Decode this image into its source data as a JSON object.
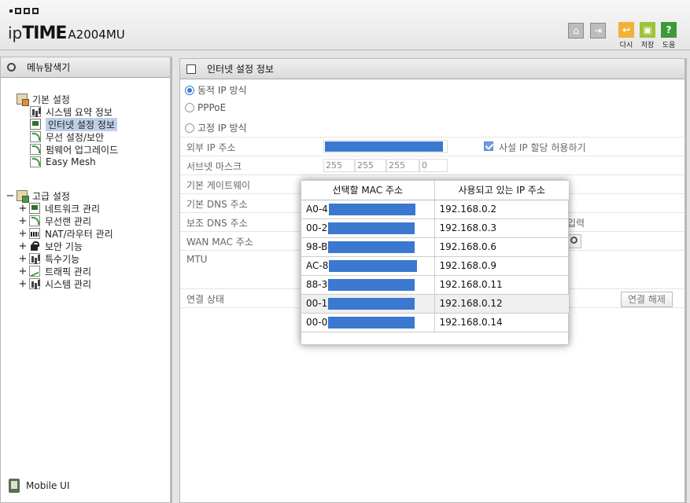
{
  "brand": {
    "logo_ip": "ip",
    "logo_time": "TIME",
    "model": "A2004MU"
  },
  "header_buttons": [
    {
      "name": "home",
      "icon": "home-icon"
    },
    {
      "name": "logout",
      "icon": "logout-icon"
    },
    {
      "name": "undo",
      "label": "다시",
      "icon": "undo-icon",
      "color": "#f0b23b"
    },
    {
      "name": "save",
      "label": "저장",
      "icon": "save-icon",
      "color": "#9cc33a"
    },
    {
      "name": "help",
      "label": "도움",
      "icon": "help-icon",
      "color": "#3c9a3a"
    }
  ],
  "sidebar": {
    "title": "메뉴탐색기",
    "basic": {
      "label": "기본 설정",
      "items": [
        "시스템 요약 정보",
        "인터넷 설정 정보",
        "무선 설정/보안",
        "펌웨어 업그레이드",
        "Easy Mesh"
      ]
    },
    "advanced": {
      "toggle": "−",
      "label": "고급 설정",
      "items": [
        "네트워크 관리",
        "무선랜 관리",
        "NAT/라우터 관리",
        "보안 기능",
        "특수기능",
        "트래픽 관리",
        "시스템 관리"
      ]
    },
    "mobile": "Mobile UI"
  },
  "main": {
    "title": "인터넷 설정 정보",
    "modes": [
      "동적 IP 방식",
      "PPPoE",
      "고정 IP 방식"
    ],
    "fields": {
      "external_ip": "외부 IP 주소",
      "subnet": "서브넷 마스크",
      "gateway": "기본 게이트웨이",
      "dns1": "기본 DNS 주소",
      "dns2": "보조 DNS 주소",
      "wan_mac": "WAN MAC 주소",
      "mtu": "MTU",
      "status": "연결 상태"
    },
    "private_ip_label": "사설 IP 할당 허용하기",
    "subnet_values": [
      "255",
      "255",
      "255",
      "0"
    ],
    "partial_input_text": "입력",
    "disconnect_button": "연결 해제"
  },
  "popup": {
    "headers": [
      "선택할 MAC 주소",
      "사용되고 있는 IP 주소"
    ],
    "rows": [
      {
        "mac": "A0-4",
        "ip": "192.168.0.2"
      },
      {
        "mac": "00-2",
        "ip": "192.168.0.3"
      },
      {
        "mac": "98-B",
        "ip": "192.168.0.6"
      },
      {
        "mac": "AC-8",
        "ip": "192.168.0.9"
      },
      {
        "mac": "88-3",
        "ip": "192.168.0.11"
      },
      {
        "mac": "00-1",
        "ip": "192.168.0.12"
      },
      {
        "mac": "00-0",
        "ip": "192.168.0.14"
      }
    ]
  }
}
